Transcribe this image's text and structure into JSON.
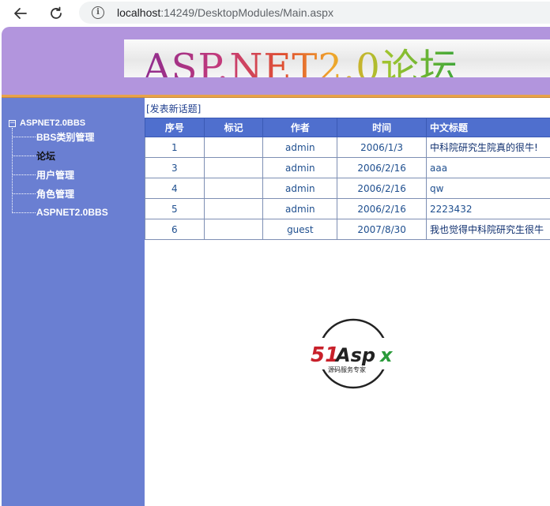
{
  "browser": {
    "url_host": "localhost",
    "url_rest": ":14249/DesktopModules/Main.aspx"
  },
  "header": {
    "banner_text": "ASP.NET2.0论坛"
  },
  "sidebar": {
    "root_label": "ASPNET2.0BBS",
    "items": [
      {
        "label": "BBS类别管理"
      },
      {
        "label": "论坛"
      },
      {
        "label": "用户管理"
      },
      {
        "label": "角色管理"
      },
      {
        "label": "ASPNET2.0BBS"
      }
    ]
  },
  "main": {
    "new_topic_link": "[发表新话题]",
    "columns": [
      "序号",
      "标记",
      "作者",
      "时间",
      "中文标题"
    ],
    "rows": [
      {
        "id": "1",
        "mark": "",
        "author": "admin",
        "time": "2006/1/3",
        "title": "中科院研究生院真的很牛!"
      },
      {
        "id": "3",
        "mark": "",
        "author": "admin",
        "time": "2006/2/16",
        "title": "aaa"
      },
      {
        "id": "4",
        "mark": "",
        "author": "admin",
        "time": "2006/2/16",
        "title": "qw"
      },
      {
        "id": "5",
        "mark": "",
        "author": "admin",
        "time": "2006/2/16",
        "title": "2223432"
      },
      {
        "id": "6",
        "mark": "",
        "author": "guest",
        "time": "2007/8/30",
        "title": "我也觉得中科院研究生很牛"
      }
    ]
  },
  "logo": {
    "brand": "51Aspx",
    "tagline": "源码服务专家"
  }
}
